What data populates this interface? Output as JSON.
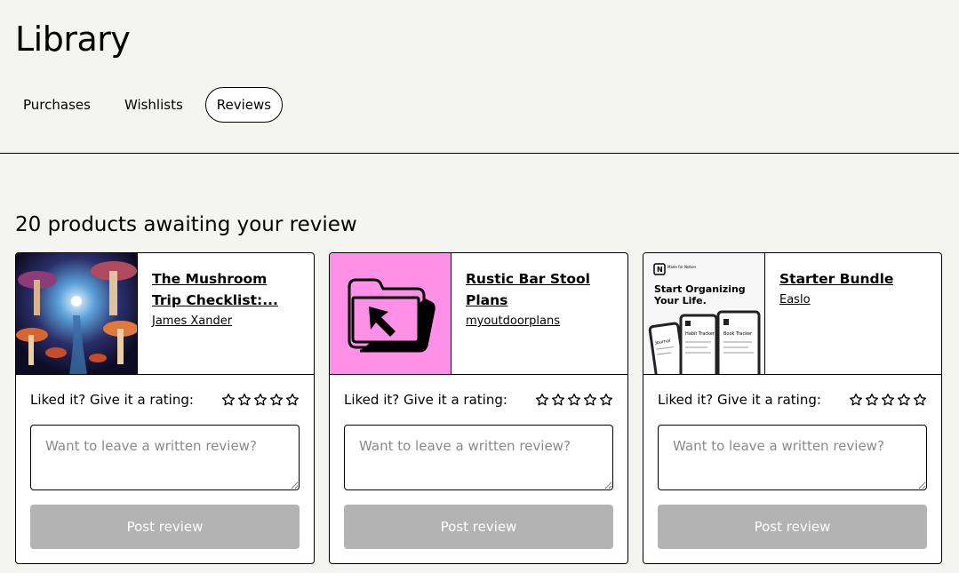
{
  "page": {
    "title": "Library"
  },
  "tabs": [
    {
      "label": "Purchases",
      "active": false
    },
    {
      "label": "Wishlists",
      "active": false
    },
    {
      "label": "Reviews",
      "active": true
    }
  ],
  "section": {
    "heading": "20 products awaiting your review"
  },
  "cards": [
    {
      "title": "The Mushroom Trip Checklist:...",
      "creator": "James Xander",
      "thumbnail": "mushroom-forest-illustration",
      "rating_label": "Liked it? Give it a rating:",
      "review_placeholder": "Want to leave a written review?",
      "post_label": "Post review"
    },
    {
      "title": "Rustic Bar Stool Plans",
      "creator": "myoutdoorplans",
      "thumbnail": "folder-cursor-icon-pink",
      "rating_label": "Liked it? Give it a rating:",
      "review_placeholder": "Want to leave a written review?",
      "post_label": "Post review"
    },
    {
      "title": "Starter Bundle",
      "creator": "Easlo",
      "thumbnail": "notion-templates-preview",
      "thumbnail_text": {
        "badge": "Made for Notion",
        "headline_1": "Start Organizing",
        "headline_2": "Your Life.",
        "tag_1": "Journal",
        "tag_2": "Habit Tracker",
        "tag_3": "Book Tracker"
      },
      "rating_label": "Liked it? Give it a rating:",
      "review_placeholder": "Want to leave a written review?",
      "post_label": "Post review"
    }
  ],
  "colors": {
    "background": "#f4f4f0",
    "pink_thumb": "#ff90e8",
    "button_disabled": "#b3b3b3"
  }
}
